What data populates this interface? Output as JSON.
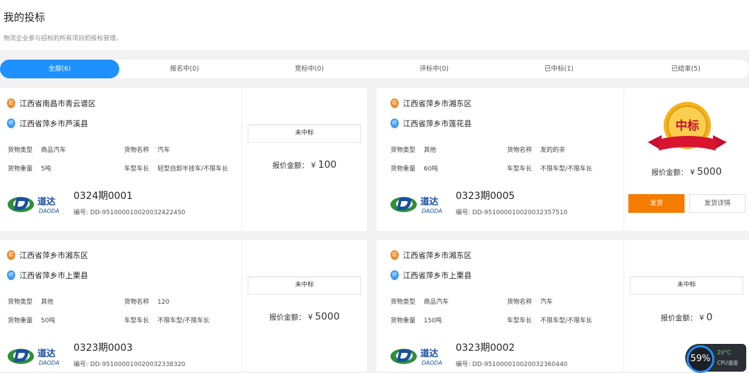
{
  "header": {
    "title": "我的投标",
    "subtitle": "物流企业参与招标的所有项目的投标管理。"
  },
  "tabs": [
    {
      "label": "全部(6)",
      "active": true
    },
    {
      "label": "报名中(0)",
      "active": false
    },
    {
      "label": "竞标中(0)",
      "active": false
    },
    {
      "label": "评标中(0)",
      "active": false
    },
    {
      "label": "已中标(1)",
      "active": false
    },
    {
      "label": "已结束(5)",
      "active": false
    }
  ],
  "labels": {
    "cargo_type": "货物类型",
    "cargo_name": "货物名称",
    "cargo_weight": "货物重量",
    "vehicle_length": "车型车长",
    "price_label": "报价金额：",
    "currency": "¥",
    "serial_prefix": "编号:",
    "start_pin": "起",
    "end_pin": "终",
    "logo_cn": "道达",
    "logo_en": "DAODA",
    "ship_button": "发货",
    "ship_detail_button": "发货详情",
    "won_seal": "中标"
  },
  "cards": [
    {
      "origin": "江西省南昌市青云谱区",
      "destination": "江西省萍乡市芦溪县",
      "cargo_type": "商品汽车",
      "cargo_name": "汽车",
      "cargo_weight": "5吨",
      "vehicle_length": "轻型自卸半挂车/不限车长",
      "order_no": "0324期0001",
      "serial": "DD-95100001002003242245​0",
      "status": "未中标",
      "price": "100"
    },
    {
      "origin": "江西省萍乡市湘东区",
      "destination": "江西省萍乡市莲花县",
      "cargo_type": "其他",
      "cargo_name": "发的的非",
      "cargo_weight": "60吨",
      "vehicle_length": "不限车型/不限车长",
      "order_no": "0323期0005",
      "serial": "DD-95100001002003235751​0",
      "status": "中标",
      "price": "5000"
    },
    {
      "origin": "江西省萍乡市湘东区",
      "destination": "江西省萍乡市上栗县",
      "cargo_type": "其他",
      "cargo_name": "120",
      "cargo_weight": "50吨",
      "vehicle_length": "不限车型/不限车长",
      "order_no": "0323期0003",
      "serial": "DD-95100001002003233832​0",
      "status": "未中标",
      "price": "5000"
    },
    {
      "origin": "江西省萍乡市湘东区",
      "destination": "江西省萍乡市上栗县",
      "cargo_type": "商品汽车",
      "cargo_name": "汽车",
      "cargo_weight": "150吨",
      "vehicle_length": "不限车型/不限车长",
      "order_no": "0323期0002",
      "serial": "DD-95100001002003236044​0",
      "status": "未中标",
      "price": "0"
    }
  ],
  "cpu_widget": {
    "percent": "59%",
    "temperature": "20°C",
    "label": "CPU温度"
  },
  "colors": {
    "accent": "#1e90ff",
    "ship_button": "#f57c00",
    "origin_pin": "#f08b2c",
    "destination_pin": "#3d9bf0"
  }
}
